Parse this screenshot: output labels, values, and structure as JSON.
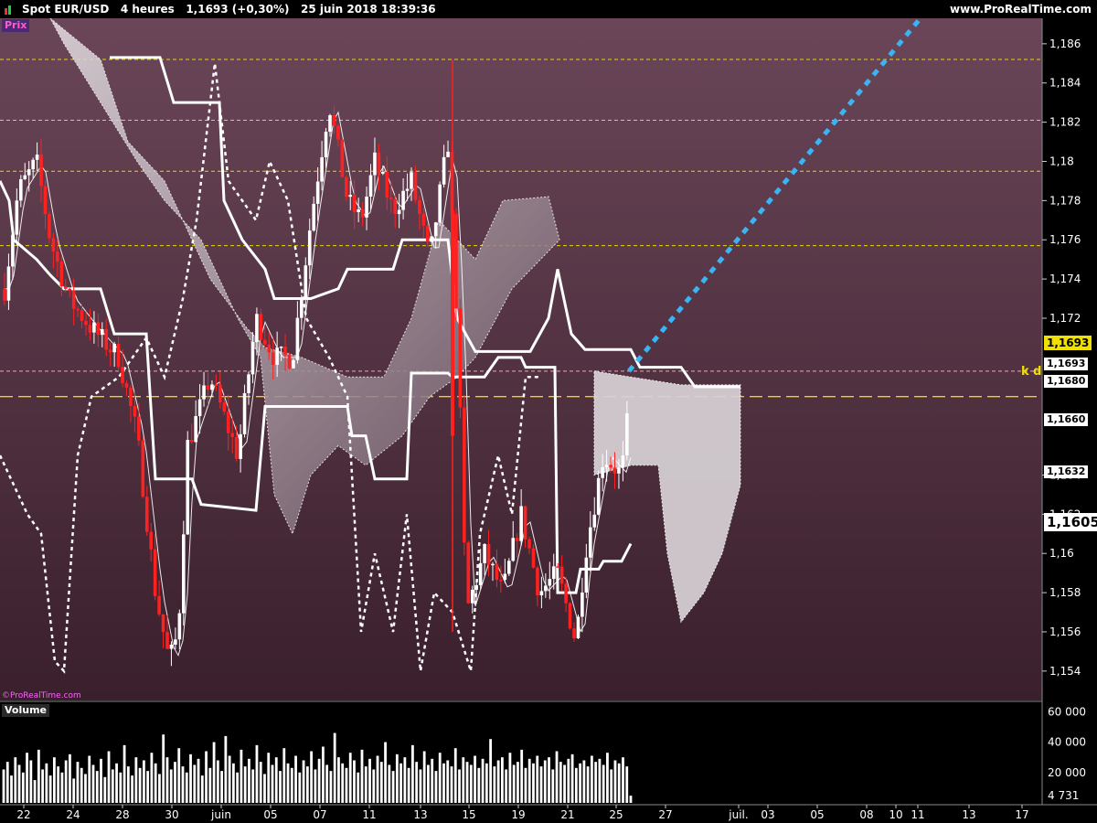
{
  "header": {
    "title": "Spot EUR/USD   4 heures   1,1693 (+0,30%)   25 juin 2018 18:39:36",
    "brand": "www.ProRealTime.com"
  },
  "panels": {
    "price_label": "Prix",
    "volume_label": "Volume",
    "watermark": "©ProRealTime.com",
    "kd_label": "k d"
  },
  "price_tags": [
    {
      "text": "1,1693",
      "kind": "current"
    },
    {
      "text": "1,1693",
      "kind": "white"
    },
    {
      "text": "1,1680",
      "kind": "white"
    },
    {
      "text": "1,1660",
      "kind": "white"
    },
    {
      "text": "1,1632",
      "kind": "white"
    },
    {
      "text": "1,1605",
      "kind": "big"
    }
  ],
  "colors": {
    "background_top": "#6a4658",
    "background_bottom": "#3a1f2c",
    "candle_up": "#ffffff",
    "candle_down": "#ff2020",
    "cloud": "#d8d2d6",
    "projection": "#3ab4f2",
    "level_line": "#e8d800",
    "current_line": "#ff9eb0",
    "current_tag_bg": "#f0e000"
  },
  "chart_data": {
    "type": "candlestick",
    "title": "Spot EUR/USD 4 heures",
    "x_ticks": [
      "22",
      "24",
      "28",
      "30",
      "juin",
      "05",
      "07",
      "11",
      "13",
      "15",
      "19",
      "21",
      "25",
      "27",
      "juil.",
      "03",
      "05",
      "08",
      "10",
      "11",
      "13",
      "17"
    ],
    "y_ticks": [
      "1,186",
      "1,184",
      "1,182",
      "1,18",
      "1,178",
      "1,176",
      "1,174",
      "1,172",
      "1,164",
      "1,162",
      "1,16",
      "1,158",
      "1,156",
      "1,154"
    ],
    "ylim": [
      1.1525,
      1.1873
    ],
    "horizontal_levels": [
      1.1852,
      1.1821,
      1.1795,
      1.1757,
      1.168,
      1.1693
    ],
    "last_price": 1.1693,
    "volume": {
      "label": "Volume",
      "y_ticks": [
        "60 000",
        "40 000",
        "20 000",
        "4 731"
      ],
      "ylim": [
        0,
        62000
      ],
      "last": 4731,
      "values": [
        22000,
        27000,
        18000,
        30000,
        25000,
        20000,
        33000,
        28000,
        15000,
        35000,
        22000,
        26000,
        18000,
        30000,
        24000,
        20000,
        28000,
        32000,
        16000,
        27000,
        23000,
        19000,
        31000,
        25000,
        21000,
        29000,
        17000,
        34000,
        22000,
        26000,
        20000,
        38000,
        24000,
        18000,
        30000,
        23000,
        28000,
        21000,
        33000,
        26000,
        19000,
        45000,
        30000,
        22000,
        27000,
        36000,
        24000,
        20000,
        32000,
        25000,
        29000,
        18000,
        34000,
        23000,
        40000,
        28000,
        21000,
        44000,
        31000,
        26000,
        20000,
        35000,
        24000,
        29000,
        22000,
        38000,
        27000,
        19000,
        33000,
        25000,
        30000,
        21000,
        36000,
        26000,
        23000,
        31000,
        20000,
        28000,
        24000,
        34000,
        22000,
        29000,
        37000,
        25000,
        21000,
        46000,
        30000,
        26000,
        23000,
        33000,
        28000,
        20000,
        35000,
        24000,
        29000,
        22000,
        31000,
        27000,
        40000,
        25000,
        21000,
        32000,
        26000,
        30000,
        23000,
        38000,
        27000,
        22000,
        34000,
        25000,
        29000,
        21000,
        33000,
        26000,
        28000,
        24000,
        36000,
        22000,
        30000,
        27000,
        25000,
        31000,
        23000,
        29000,
        26000,
        42000,
        24000,
        28000,
        30000,
        22000,
        33000,
        25000,
        27000,
        35000,
        23000,
        29000,
        26000,
        31000,
        24000,
        28000,
        30000,
        22000,
        34000,
        27000,
        25000,
        29000,
        32000,
        23000,
        26000,
        28000,
        24000,
        31000,
        27000,
        29000,
        25000,
        33000,
        22000,
        28000,
        26000,
        30000,
        24000,
        4731
      ]
    },
    "projection": {
      "from": [
        25.5,
        1.1693
      ],
      "to": [
        28.0,
        1.1872
      ]
    }
  }
}
